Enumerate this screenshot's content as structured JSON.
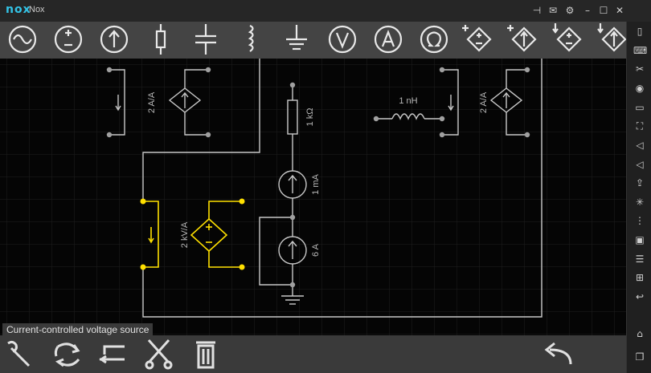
{
  "window": {
    "logo": "nox",
    "title": "Nox"
  },
  "titlebar_buttons": [
    "pin-icon",
    "mail-icon",
    "gear-icon",
    "minimize-icon",
    "maximize-icon",
    "close-icon"
  ],
  "toolbar": {
    "tools": [
      "ac-voltage-source",
      "dc-voltage-source",
      "current-source",
      "resistor",
      "capacitor",
      "inductor",
      "ground",
      "voltmeter",
      "ammeter",
      "ohmmeter",
      "voltage-controlled-voltage-source",
      "voltage-controlled-current-source",
      "current-controlled-voltage-source",
      "current-controlled-current-source"
    ]
  },
  "circuit": {
    "labels": {
      "cccs_top_left": "2 A/A",
      "resistor": "1 kΩ",
      "current_source_1": "1 mA",
      "current_source_2": "6 A",
      "inductor": "1 nH",
      "cccs_top_right": "2 A/A",
      "ccvs_selected": "2 kV/A"
    },
    "colors": {
      "wire": "#c8c8c8",
      "node": "#a0a0a0",
      "selected": "#ffe000",
      "grid": "#1c1c1c"
    }
  },
  "tooltip": "Current-controlled voltage source",
  "bottom_toolbar": [
    "wrench-icon",
    "rotate-icon",
    "flip-icon",
    "cut-icon",
    "trash-icon",
    "undo-icon"
  ],
  "sidebar_icons": [
    "phone-icon",
    "keyboard-icon",
    "scissors-icon",
    "location-icon",
    "screen-icon",
    "fullscreen-icon",
    "volume-up-icon",
    "volume-down-icon",
    "apk-icon",
    "shake-icon",
    "macro-icon",
    "record-icon",
    "multi-instance-icon",
    "more-icon",
    "back-icon",
    "home-icon",
    "recent-apps-icon"
  ]
}
